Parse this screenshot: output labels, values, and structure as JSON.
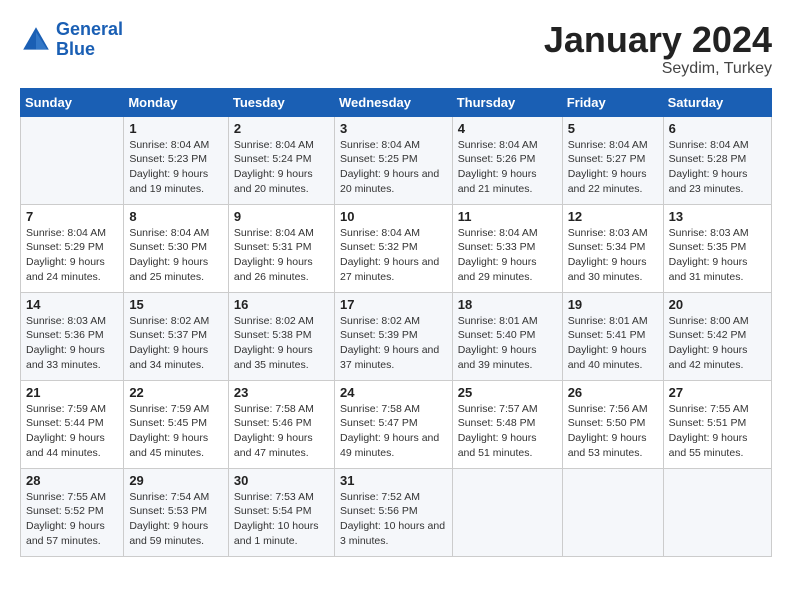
{
  "header": {
    "logo": "GeneralBlue",
    "month": "January 2024",
    "location": "Seydim, Turkey"
  },
  "columns": [
    "Sunday",
    "Monday",
    "Tuesday",
    "Wednesday",
    "Thursday",
    "Friday",
    "Saturday"
  ],
  "weeks": [
    [
      {
        "day": "",
        "sunrise": "",
        "sunset": "",
        "daylight": ""
      },
      {
        "day": "1",
        "sunrise": "Sunrise: 8:04 AM",
        "sunset": "Sunset: 5:23 PM",
        "daylight": "Daylight: 9 hours and 19 minutes."
      },
      {
        "day": "2",
        "sunrise": "Sunrise: 8:04 AM",
        "sunset": "Sunset: 5:24 PM",
        "daylight": "Daylight: 9 hours and 20 minutes."
      },
      {
        "day": "3",
        "sunrise": "Sunrise: 8:04 AM",
        "sunset": "Sunset: 5:25 PM",
        "daylight": "Daylight: 9 hours and 20 minutes."
      },
      {
        "day": "4",
        "sunrise": "Sunrise: 8:04 AM",
        "sunset": "Sunset: 5:26 PM",
        "daylight": "Daylight: 9 hours and 21 minutes."
      },
      {
        "day": "5",
        "sunrise": "Sunrise: 8:04 AM",
        "sunset": "Sunset: 5:27 PM",
        "daylight": "Daylight: 9 hours and 22 minutes."
      },
      {
        "day": "6",
        "sunrise": "Sunrise: 8:04 AM",
        "sunset": "Sunset: 5:28 PM",
        "daylight": "Daylight: 9 hours and 23 minutes."
      }
    ],
    [
      {
        "day": "7",
        "sunrise": "Sunrise: 8:04 AM",
        "sunset": "Sunset: 5:29 PM",
        "daylight": "Daylight: 9 hours and 24 minutes."
      },
      {
        "day": "8",
        "sunrise": "Sunrise: 8:04 AM",
        "sunset": "Sunset: 5:30 PM",
        "daylight": "Daylight: 9 hours and 25 minutes."
      },
      {
        "day": "9",
        "sunrise": "Sunrise: 8:04 AM",
        "sunset": "Sunset: 5:31 PM",
        "daylight": "Daylight: 9 hours and 26 minutes."
      },
      {
        "day": "10",
        "sunrise": "Sunrise: 8:04 AM",
        "sunset": "Sunset: 5:32 PM",
        "daylight": "Daylight: 9 hours and 27 minutes."
      },
      {
        "day": "11",
        "sunrise": "Sunrise: 8:04 AM",
        "sunset": "Sunset: 5:33 PM",
        "daylight": "Daylight: 9 hours and 29 minutes."
      },
      {
        "day": "12",
        "sunrise": "Sunrise: 8:03 AM",
        "sunset": "Sunset: 5:34 PM",
        "daylight": "Daylight: 9 hours and 30 minutes."
      },
      {
        "day": "13",
        "sunrise": "Sunrise: 8:03 AM",
        "sunset": "Sunset: 5:35 PM",
        "daylight": "Daylight: 9 hours and 31 minutes."
      }
    ],
    [
      {
        "day": "14",
        "sunrise": "Sunrise: 8:03 AM",
        "sunset": "Sunset: 5:36 PM",
        "daylight": "Daylight: 9 hours and 33 minutes."
      },
      {
        "day": "15",
        "sunrise": "Sunrise: 8:02 AM",
        "sunset": "Sunset: 5:37 PM",
        "daylight": "Daylight: 9 hours and 34 minutes."
      },
      {
        "day": "16",
        "sunrise": "Sunrise: 8:02 AM",
        "sunset": "Sunset: 5:38 PM",
        "daylight": "Daylight: 9 hours and 35 minutes."
      },
      {
        "day": "17",
        "sunrise": "Sunrise: 8:02 AM",
        "sunset": "Sunset: 5:39 PM",
        "daylight": "Daylight: 9 hours and 37 minutes."
      },
      {
        "day": "18",
        "sunrise": "Sunrise: 8:01 AM",
        "sunset": "Sunset: 5:40 PM",
        "daylight": "Daylight: 9 hours and 39 minutes."
      },
      {
        "day": "19",
        "sunrise": "Sunrise: 8:01 AM",
        "sunset": "Sunset: 5:41 PM",
        "daylight": "Daylight: 9 hours and 40 minutes."
      },
      {
        "day": "20",
        "sunrise": "Sunrise: 8:00 AM",
        "sunset": "Sunset: 5:42 PM",
        "daylight": "Daylight: 9 hours and 42 minutes."
      }
    ],
    [
      {
        "day": "21",
        "sunrise": "Sunrise: 7:59 AM",
        "sunset": "Sunset: 5:44 PM",
        "daylight": "Daylight: 9 hours and 44 minutes."
      },
      {
        "day": "22",
        "sunrise": "Sunrise: 7:59 AM",
        "sunset": "Sunset: 5:45 PM",
        "daylight": "Daylight: 9 hours and 45 minutes."
      },
      {
        "day": "23",
        "sunrise": "Sunrise: 7:58 AM",
        "sunset": "Sunset: 5:46 PM",
        "daylight": "Daylight: 9 hours and 47 minutes."
      },
      {
        "day": "24",
        "sunrise": "Sunrise: 7:58 AM",
        "sunset": "Sunset: 5:47 PM",
        "daylight": "Daylight: 9 hours and 49 minutes."
      },
      {
        "day": "25",
        "sunrise": "Sunrise: 7:57 AM",
        "sunset": "Sunset: 5:48 PM",
        "daylight": "Daylight: 9 hours and 51 minutes."
      },
      {
        "day": "26",
        "sunrise": "Sunrise: 7:56 AM",
        "sunset": "Sunset: 5:50 PM",
        "daylight": "Daylight: 9 hours and 53 minutes."
      },
      {
        "day": "27",
        "sunrise": "Sunrise: 7:55 AM",
        "sunset": "Sunset: 5:51 PM",
        "daylight": "Daylight: 9 hours and 55 minutes."
      }
    ],
    [
      {
        "day": "28",
        "sunrise": "Sunrise: 7:55 AM",
        "sunset": "Sunset: 5:52 PM",
        "daylight": "Daylight: 9 hours and 57 minutes."
      },
      {
        "day": "29",
        "sunrise": "Sunrise: 7:54 AM",
        "sunset": "Sunset: 5:53 PM",
        "daylight": "Daylight: 9 hours and 59 minutes."
      },
      {
        "day": "30",
        "sunrise": "Sunrise: 7:53 AM",
        "sunset": "Sunset: 5:54 PM",
        "daylight": "Daylight: 10 hours and 1 minute."
      },
      {
        "day": "31",
        "sunrise": "Sunrise: 7:52 AM",
        "sunset": "Sunset: 5:56 PM",
        "daylight": "Daylight: 10 hours and 3 minutes."
      },
      {
        "day": "",
        "sunrise": "",
        "sunset": "",
        "daylight": ""
      },
      {
        "day": "",
        "sunrise": "",
        "sunset": "",
        "daylight": ""
      },
      {
        "day": "",
        "sunrise": "",
        "sunset": "",
        "daylight": ""
      }
    ]
  ]
}
